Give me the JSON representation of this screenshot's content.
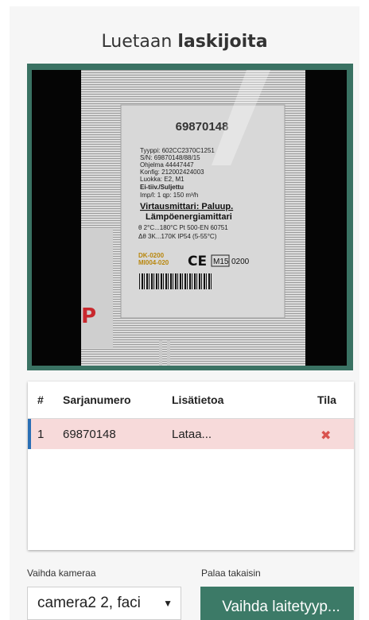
{
  "page": {
    "title_plain": "Luetaan",
    "title_bold": "laskijoita"
  },
  "camera_image": {
    "label_serial_header": "69870148",
    "label_lines": [
      "Tyyppi: 602CC2370C1251",
      "S/N: 69870148/88/15",
      "Ohjelma 44447447",
      "Konfig: 212002424003",
      "Luokka: E2, M1",
      "Ei-tiiv./Suljettu",
      "Imp/l: 1    qp: 150 m³/h"
    ],
    "label_heading": "Virtausmittari: Paluup.",
    "label_subheading": "Lämpöenergiamittari",
    "label_spec1": "θ 2°C...180°C Pt 500-EN 60751",
    "label_spec2": "Δθ 3K...170K  IP54 (5-55°C)",
    "label_code1": "DK-0200",
    "label_code2": "MI004-020",
    "label_ce": "CE",
    "label_m15": "M15",
    "label_0200": "0200"
  },
  "table": {
    "headers": {
      "num": "#",
      "serial": "Sarjanumero",
      "info": "Lisätietoa",
      "state": "Tila"
    },
    "rows": [
      {
        "num": "1",
        "serial": "69870148",
        "info": "Lataa...",
        "state_icon": "✖"
      }
    ]
  },
  "controls": {
    "camera_label": "Vaihda kameraa",
    "camera_selected": "camera2 2, faci",
    "camera_arrow": "▼",
    "back_label": "Palaa takaisin",
    "device_button": "Vaihda laitetyyp..."
  },
  "colors": {
    "accent_green": "#3c7a67",
    "row_error_bg": "#f7dada",
    "remove_red": "#d9534f",
    "row_marker_blue": "#2a6fb5"
  }
}
